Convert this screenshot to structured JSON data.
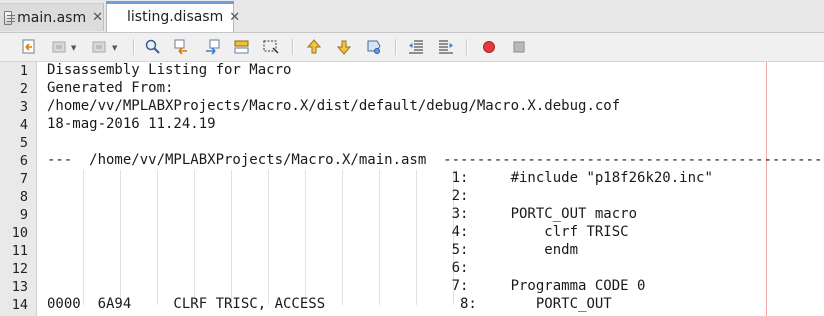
{
  "tabs": [
    {
      "label": "main.asm",
      "close": "✕"
    },
    {
      "label": "listing.disasm",
      "close": "✕"
    }
  ],
  "toolbar": {
    "buttons": [
      {
        "name": "back-source-icon"
      },
      {
        "name": "run-history-icon"
      },
      {
        "name": "history-forward-icon"
      },
      {
        "name": "find-icon"
      },
      {
        "name": "find-previous-icon"
      },
      {
        "name": "find-next-icon"
      },
      {
        "name": "toggle-highlight-icon"
      },
      {
        "name": "toggle-selection-icon"
      },
      {
        "name": "previous-bookmark-icon"
      },
      {
        "name": "next-bookmark-icon"
      },
      {
        "name": "toggle-bookmark-icon"
      },
      {
        "name": "shift-left-icon"
      },
      {
        "name": "shift-right-icon"
      },
      {
        "name": "start-macro-icon"
      },
      {
        "name": "stop-macro-icon"
      }
    ]
  },
  "editor": {
    "lines": [
      {
        "num": "1",
        "text": "Disassembly Listing for Macro"
      },
      {
        "num": "2",
        "text": "Generated From:"
      },
      {
        "num": "3",
        "text": "/home/vv/MPLABXProjects/Macro.X/dist/default/debug/Macro.X.debug.cof"
      },
      {
        "num": "4",
        "text": "18-mag-2016 11.24.19"
      },
      {
        "num": "5",
        "text": ""
      },
      {
        "num": "6",
        "text": "---  /home/vv/MPLABXProjects/Macro.X/main.asm  ------------------------------------------------"
      },
      {
        "num": "7",
        "text": "                                                1:     #include \"p18f26k20.inc\""
      },
      {
        "num": "8",
        "text": "                                                2:"
      },
      {
        "num": "9",
        "text": "                                                3:     PORTC_OUT macro"
      },
      {
        "num": "10",
        "text": "                                                4:         clrf TRISC"
      },
      {
        "num": "11",
        "text": "                                                5:         endm"
      },
      {
        "num": "12",
        "text": "                                                6:"
      },
      {
        "num": "13",
        "text": "                                                7:     Programma CODE 0"
      },
      {
        "num": "14",
        "text": "0000  6A94     CLRF TRISC, ACCESS                8:       PORTC_OUT"
      }
    ]
  }
}
